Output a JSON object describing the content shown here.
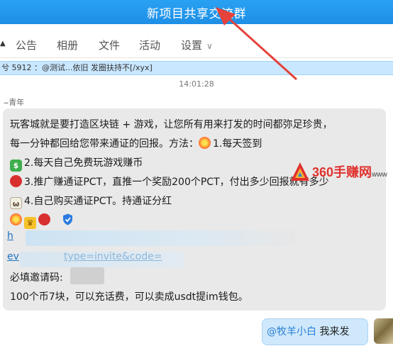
{
  "window": {
    "title": "新项目共享交流群"
  },
  "tabs": [
    {
      "label": "公告"
    },
    {
      "label": "相册"
    },
    {
      "label": "文件"
    },
    {
      "label": "活动"
    },
    {
      "label": "设置",
      "dropdown": true
    }
  ],
  "banner": {
    "text": "兮  5912 ：@测试...依旧 发圈扶持不[/xyx]"
  },
  "timestamp": "14:01:28",
  "message": {
    "sender": "青年",
    "lines": [
      "玩客城就是要打造区块链 + 游戏，让您所有用来打发的时间都弥足珍贵，",
      "每一分钟都回给您带来通证的回报。方法：",
      "1.每天签到",
      "2.每天自己免费玩游戏赚币",
      "3.推广赚通证PCT，直推一个奖励200个PCT，付出多少回报就有多少",
      "4.自己购买通证PCT。持通证分红",
      "必填邀请码:",
      "100个币7块，可以充话费，可以卖成usdt提im钱包。"
    ],
    "link_fragments": [
      "h",
      "ev",
      "type=invite&code="
    ]
  },
  "reply": {
    "mention": "@牧羊小白",
    "text": "我来发"
  },
  "watermark": {
    "brand": "360手赚网",
    "sub": "www"
  },
  "icons": {
    "boom": "collision-emoji-icon",
    "money": "money-emoji-icon",
    "dance": "dancer-emoji-icon",
    "cow": "cow-emoji-icon",
    "crown": "crown-emoji-icon",
    "shield": "shield-icon"
  },
  "colors": {
    "titlebar": "#1e8fe6",
    "banner": "#c9e7ff",
    "bubble": "#e9e9e9",
    "reply_bubble": "#cfe8fb",
    "arrow": "#e5423b"
  }
}
